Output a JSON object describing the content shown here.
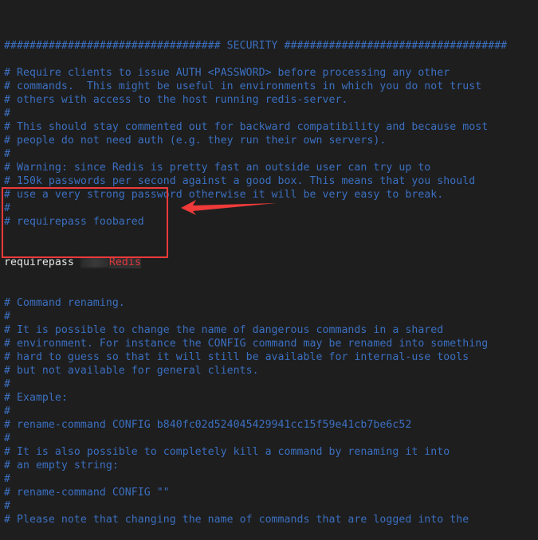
{
  "editor": {
    "lines": [
      "################################## SECURITY ###################################",
      "",
      "# Require clients to issue AUTH <PASSWORD> before processing any other",
      "# commands.  This might be useful in environments in which you do not trust",
      "# others with access to the host running redis-server.",
      "#",
      "# This should stay commented out for backward compatibility and because most",
      "# people do not need auth (e.g. they run their own servers).",
      "#",
      "# Warning: since Redis is pretty fast an outside user can try up to",
      "# 150k passwords per second against a good box. This means that you should",
      "# use a very strong password otherwise it will be very easy to break.",
      "#",
      "# requirepass foobared"
    ],
    "requirepass_key": "requirepass ",
    "requirepass_value": "Redis",
    "lines_after": [
      "# Command renaming.",
      "#",
      "# It is possible to change the name of dangerous commands in a shared",
      "# environment. For instance the CONFIG command may be renamed into something",
      "# hard to guess so that it will still be available for internal-use tools",
      "# but not available for general clients.",
      "#",
      "# Example:",
      "#",
      "# rename-command CONFIG b840fc02d524045429941cc15f59e41cb7be6c52",
      "#",
      "# It is also possible to completely kill a command by renaming it into",
      "# an empty string:",
      "#",
      "# rename-command CONFIG \"\"",
      "#",
      "# Please note that changing the name of commands that are logged into the"
    ]
  },
  "colors": {
    "background": "#1e1e1e",
    "comment": "#3b6fc0",
    "annotation": "#ef3a3a"
  }
}
